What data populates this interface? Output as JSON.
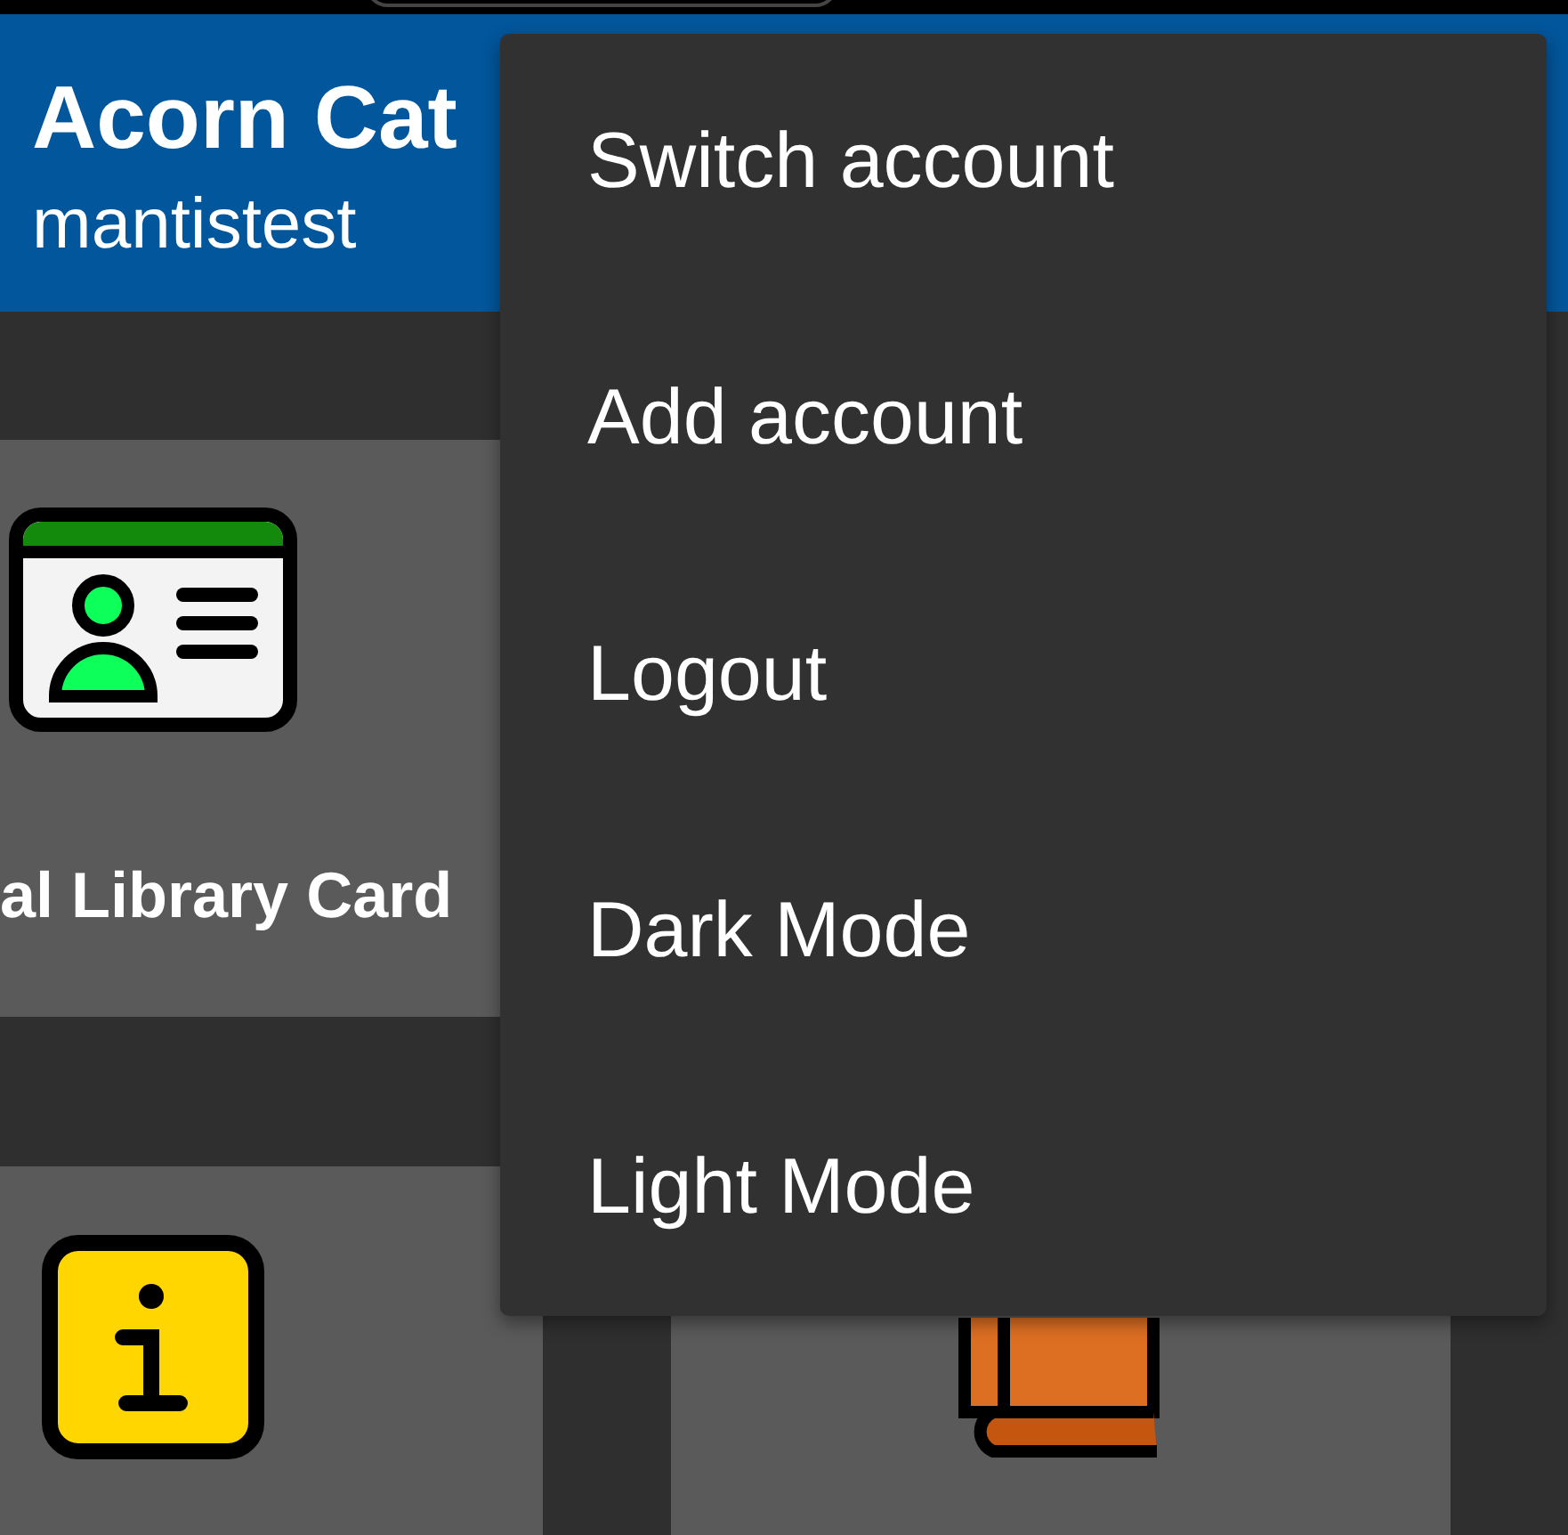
{
  "header": {
    "title": "Acorn Cat",
    "subtitle": "mantistest"
  },
  "cards": [
    {
      "kind": "id-card",
      "label": "al Library Card"
    },
    {
      "kind": "info"
    },
    {
      "kind": "book"
    }
  ],
  "menu": {
    "items": [
      {
        "label": "Switch account"
      },
      {
        "label": "Add account"
      },
      {
        "label": "Logout"
      },
      {
        "label": "Dark Mode"
      },
      {
        "label": "Light Mode"
      }
    ]
  }
}
